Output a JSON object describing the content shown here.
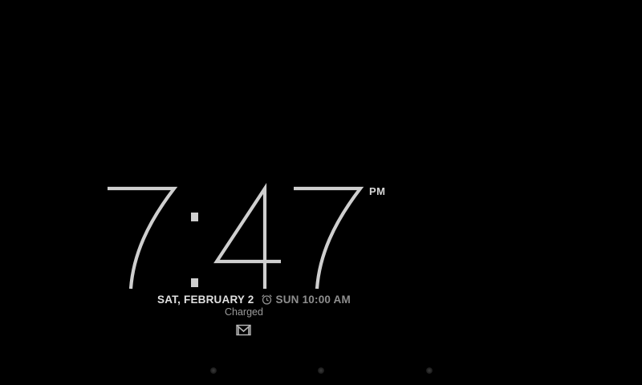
{
  "clock": {
    "time": "7:47",
    "ampm": "PM"
  },
  "date": "SAT, FEBRUARY 2",
  "alarm": {
    "icon": "alarm-clock-icon",
    "text": "SUN 10:00 AM"
  },
  "battery_status": "Charged",
  "notification_icon": "gmail-icon",
  "widget_pages": {
    "count": 3
  },
  "colors": {
    "background": "#000000",
    "clock_digits": "#cfcfcf",
    "date_text": "#e0e0e0",
    "secondary_text": "#8e8e8e"
  }
}
